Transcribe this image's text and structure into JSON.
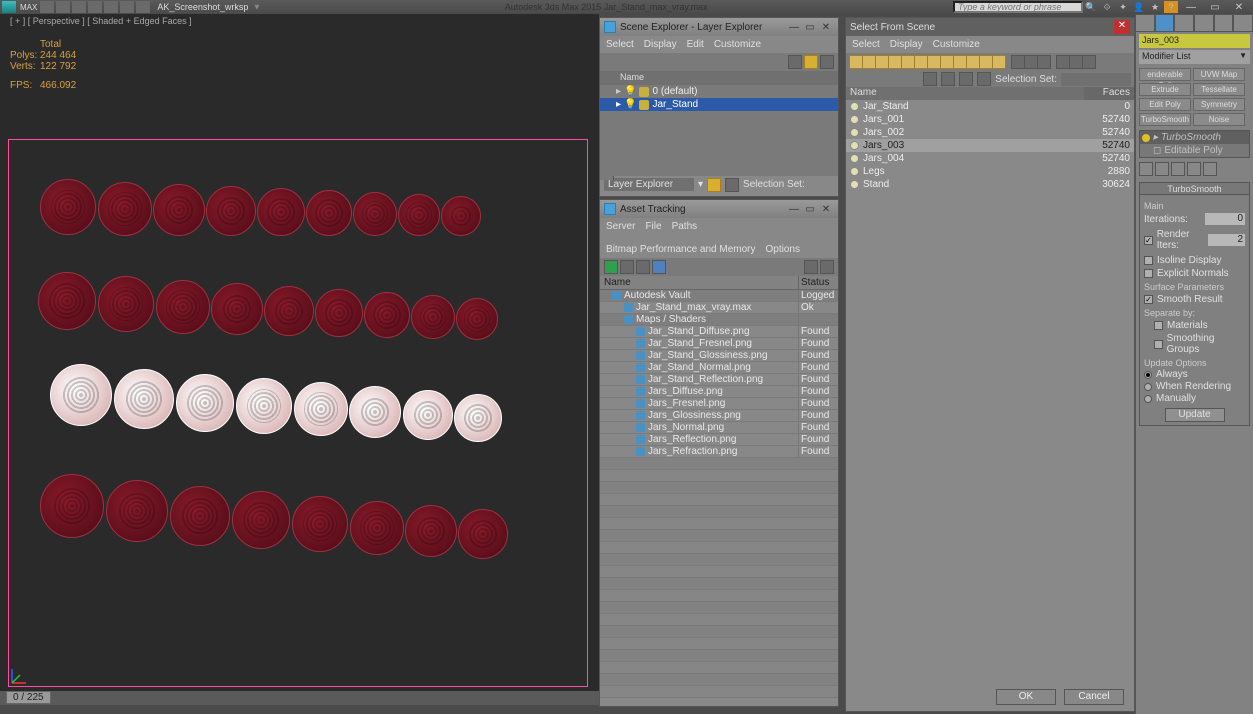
{
  "titlebar": {
    "workspace": "AK_Screenshot_wrksp",
    "title": "Autodesk 3ds Max 2015    Jar_Stand_max_vray.max",
    "search_placeholder": "Type a keyword or phrase"
  },
  "viewport": {
    "label": "[ + ] [ Perspective ] [ Shaded + Edged Faces ]",
    "stats": {
      "total_label": "Total",
      "polys_label": "Polys:",
      "polys": "244 464",
      "verts_label": "Verts:",
      "verts": "122 792",
      "fps_label": "FPS:",
      "fps": "466.092"
    },
    "timeline": "0 / 225"
  },
  "scene_explorer": {
    "title": "Scene Explorer - Layer Explorer",
    "menus": [
      "Select",
      "Display",
      "Edit",
      "Customize"
    ],
    "col_name": "Name",
    "rows": [
      {
        "label": "0 (default)",
        "selected": false
      },
      {
        "label": "Jar_Stand",
        "selected": true
      }
    ],
    "footer_label": "Layer Explorer",
    "selection_set": "Selection Set:"
  },
  "asset_tracking": {
    "title": "Asset Tracking",
    "menus": [
      "Server",
      "File",
      "Paths",
      "Bitmap Performance and Memory",
      "Options"
    ],
    "col_name": "Name",
    "col_status": "Status",
    "rows": [
      {
        "name": "Autodesk Vault",
        "status": "Logged",
        "indent": 1,
        "hdr": true
      },
      {
        "name": "Jar_Stand_max_vray.max",
        "status": "Ok",
        "indent": 2
      },
      {
        "name": "Maps / Shaders",
        "status": "",
        "indent": 2,
        "hdr": true
      },
      {
        "name": "Jar_Stand_Diffuse.png",
        "status": "Found",
        "indent": 3
      },
      {
        "name": "Jar_Stand_Fresnel.png",
        "status": "Found",
        "indent": 3
      },
      {
        "name": "Jar_Stand_Glossiness.png",
        "status": "Found",
        "indent": 3
      },
      {
        "name": "Jar_Stand_Normal.png",
        "status": "Found",
        "indent": 3
      },
      {
        "name": "Jar_Stand_Reflection.png",
        "status": "Found",
        "indent": 3
      },
      {
        "name": "Jars_Diffuse.png",
        "status": "Found",
        "indent": 3
      },
      {
        "name": "Jars_Fresnel.png",
        "status": "Found",
        "indent": 3
      },
      {
        "name": "Jars_Glossiness.png",
        "status": "Found",
        "indent": 3
      },
      {
        "name": "Jars_Normal.png",
        "status": "Found",
        "indent": 3
      },
      {
        "name": "Jars_Reflection.png",
        "status": "Found",
        "indent": 3
      },
      {
        "name": "Jars_Refraction.png",
        "status": "Found",
        "indent": 3
      }
    ]
  },
  "select_from_scene": {
    "title": "Select From Scene",
    "menus": [
      "Select",
      "Display",
      "Customize"
    ],
    "selection_set": "Selection Set:",
    "col_name": "Name",
    "col_faces": "Faces",
    "rows": [
      {
        "name": "Jar_Stand",
        "faces": "0"
      },
      {
        "name": "Jars_001",
        "faces": "52740"
      },
      {
        "name": "Jars_002",
        "faces": "52740"
      },
      {
        "name": "Jars_003",
        "faces": "52740",
        "hl": true
      },
      {
        "name": "Jars_004",
        "faces": "52740"
      },
      {
        "name": "Legs",
        "faces": "2880"
      },
      {
        "name": "Stand",
        "faces": "30624"
      }
    ],
    "ok": "OK",
    "cancel": "Cancel"
  },
  "command_panel": {
    "object_name": "Jars_003",
    "modifier_list": "Modifier List",
    "mod_buttons": [
      "enderable Spli",
      "UVW Map",
      "Extrude",
      "Tessellate",
      "Edit Poly",
      "Symmetry",
      "TurboSmooth",
      "Noise"
    ],
    "stack": [
      {
        "label": "TurboSmooth",
        "on": true
      },
      {
        "label": "Editable Poly",
        "on": false
      }
    ],
    "rollout": {
      "title": "TurboSmooth",
      "main": "Main",
      "iterations_label": "Iterations:",
      "iterations": "0",
      "render_iters_label": "Render Iters:",
      "render_iters": "2",
      "render_iters_checked": true,
      "isoline": "Isoline Display",
      "isoline_checked": false,
      "explicit": "Explicit Normals",
      "explicit_checked": false,
      "surface_params": "Surface Parameters",
      "smooth_result": "Smooth Result",
      "smooth_result_checked": true,
      "separate": "Separate by:",
      "materials": "Materials",
      "materials_checked": false,
      "smoothing_groups": "Smoothing Groups",
      "smoothing_groups_checked": false,
      "update_options": "Update Options",
      "always": "Always",
      "when_rendering": "When Rendering",
      "manually": "Manually",
      "update_btn": "Update"
    }
  }
}
